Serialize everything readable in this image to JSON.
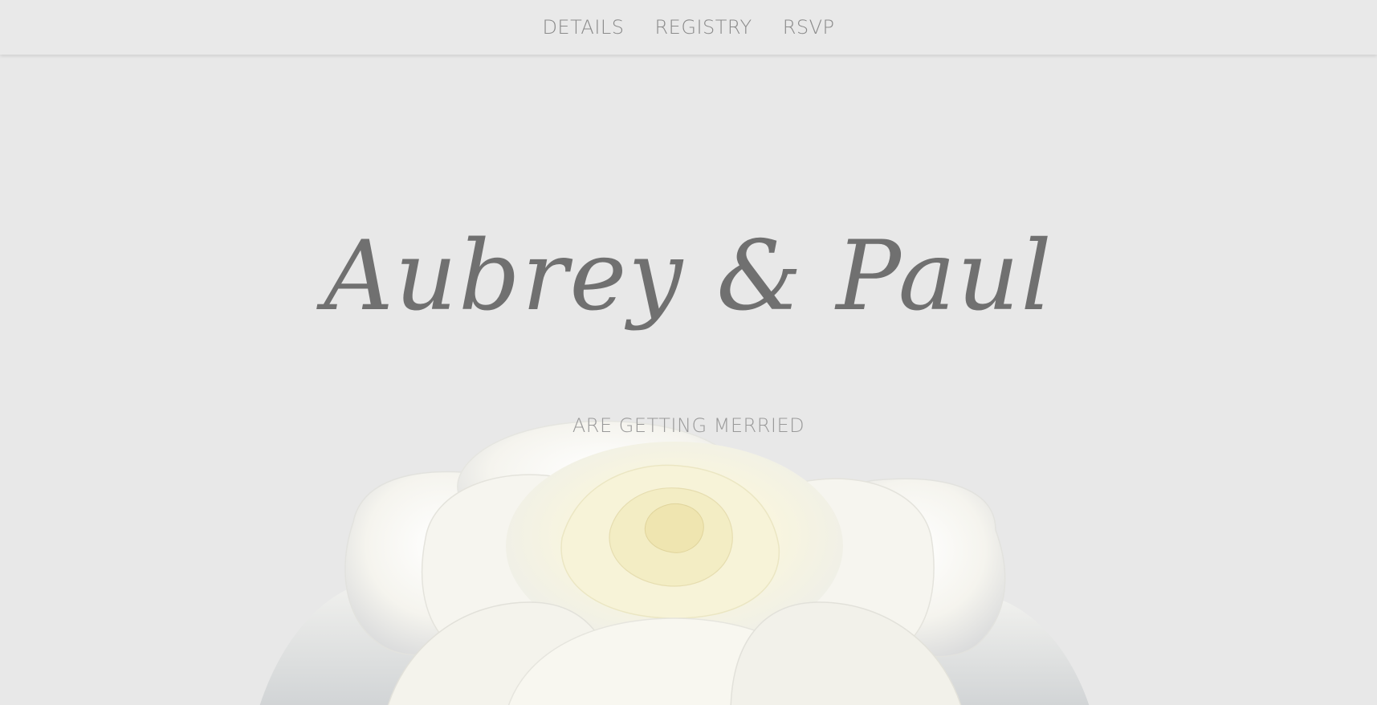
{
  "nav": {
    "items": [
      {
        "label": "DETAILS"
      },
      {
        "label": "REGISTRY"
      },
      {
        "label": "RSVP"
      }
    ]
  },
  "hero": {
    "title": "Aubrey & Paul",
    "subtitle": "ARE GETTING MERRIED"
  },
  "colors": {
    "background": "#e8e8e8",
    "nav_text": "#8a8a8a",
    "title_text": "#707070",
    "subtitle_text": "#999999",
    "rose_petal": "#f7f6ee",
    "rose_center": "#f2efcf"
  }
}
